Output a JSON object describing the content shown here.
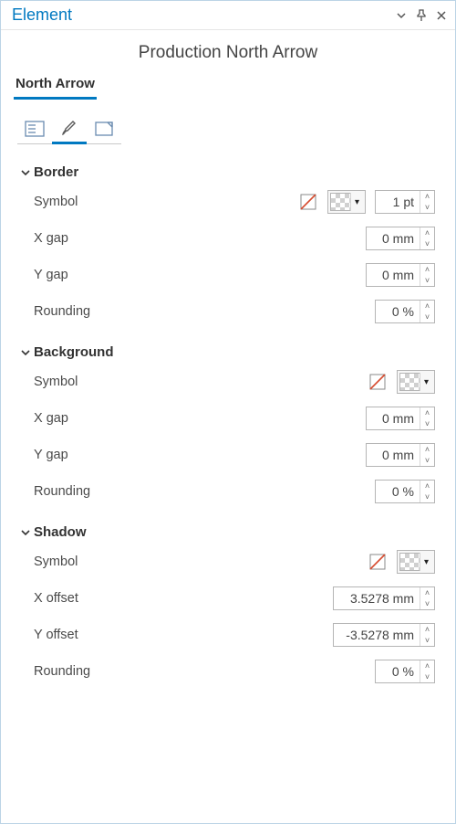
{
  "panel": {
    "title": "Element"
  },
  "subtitle": "Production North Arrow",
  "tabs": {
    "north_arrow": "North Arrow"
  },
  "sections": {
    "border": {
      "title": "Border",
      "symbol_label": "Symbol",
      "size_value": "1 pt",
      "xgap_label": "X gap",
      "xgap_value": "0 mm",
      "ygap_label": "Y gap",
      "ygap_value": "0 mm",
      "rounding_label": "Rounding",
      "rounding_value": "0 %"
    },
    "background": {
      "title": "Background",
      "symbol_label": "Symbol",
      "xgap_label": "X gap",
      "xgap_value": "0 mm",
      "ygap_label": "Y gap",
      "ygap_value": "0 mm",
      "rounding_label": "Rounding",
      "rounding_value": "0 %"
    },
    "shadow": {
      "title": "Shadow",
      "symbol_label": "Symbol",
      "xoff_label": "X offset",
      "xoff_value": "3.5278 mm",
      "yoff_label": "Y offset",
      "yoff_value": "-3.5278 mm",
      "rounding_label": "Rounding",
      "rounding_value": "0 %"
    }
  }
}
